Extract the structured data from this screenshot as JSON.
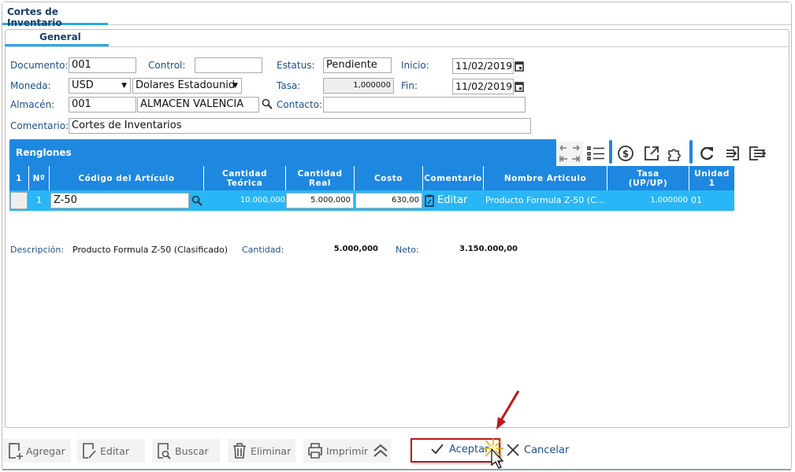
{
  "window": {
    "tab": "Cortes de Inventario"
  },
  "form": {
    "tab": "General",
    "documento_label": "Documento:",
    "documento": "001",
    "control_label": "Control:",
    "control": "",
    "estatus_label": "Estatus:",
    "estatus": "Pendiente",
    "inicio_label": "Inicio:",
    "inicio": "11/02/2019",
    "moneda_label": "Moneda:",
    "moneda": "USD",
    "moneda_nombre": "Dolares Estadounid",
    "tasa_label": "Tasa:",
    "tasa": "1,000000",
    "fin_label": "Fin:",
    "fin": "11/02/2019",
    "almacen_label": "Almacén:",
    "almacen": "001",
    "almacen_nombre": "ALMACEN VALENCIA",
    "contacto_label": "Contacto:",
    "contacto": "",
    "comentario_label": "Comentario:",
    "comentario": "Cortes de Inventarios"
  },
  "grid": {
    "title": "Renglones",
    "columns": [
      "1",
      "Nº",
      "Código del Artículo",
      "Cantidad Teórica",
      "Cantidad Real",
      "Costo",
      "Comentario",
      "Nombre Articulo",
      "Tasa (UP/UP)",
      "Unidad 1"
    ],
    "rows": [
      {
        "n": "1",
        "codigo": "Z-50",
        "teorica": "10.000,000",
        "real": "5.000,000",
        "costo": "630,00",
        "comentario": "Editar",
        "nombre": "Producto Formula Z-50 (C...",
        "tasa": "1,000000",
        "unidad": "01"
      }
    ]
  },
  "summary": {
    "descripcion_label": "Descripción:",
    "descripcion": "Producto Formula Z-50 (Clasificado)",
    "cantidad_label": "Cantidad:",
    "cantidad": "5.000,000",
    "neto_label": "Neto:",
    "neto": "3.150.000,00"
  },
  "footer": {
    "agregar": "Agregar",
    "editar": "Editar",
    "buscar": "Buscar",
    "eliminar": "Eliminar",
    "imprimir": "Imprimir",
    "aceptar": "Aceptar",
    "cancelar": "Cancelar"
  },
  "colors": {
    "accent": "#1e88e0",
    "row": "#29b6f6",
    "highlight": "#c0161c"
  }
}
